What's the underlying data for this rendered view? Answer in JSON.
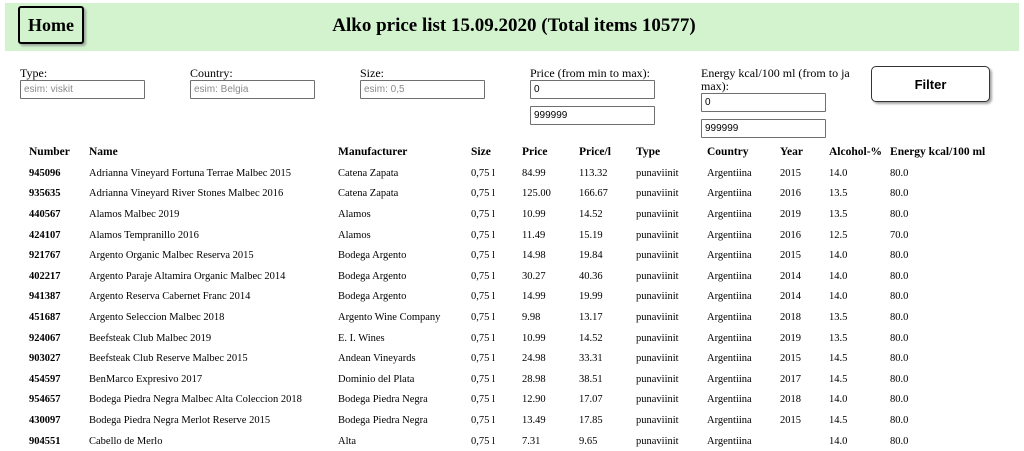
{
  "header": {
    "home_label": "Home",
    "title": "Alko price list 15.09.2020 (Total items 10577)"
  },
  "filters": {
    "type": {
      "label": "Type:",
      "placeholder": "esim: viskit",
      "value": ""
    },
    "country": {
      "label": "Country:",
      "placeholder": "esim: Belgia",
      "value": ""
    },
    "size": {
      "label": "Size:",
      "placeholder": "esim: 0,5",
      "value": ""
    },
    "price": {
      "label": "Price (from min to max):",
      "min": "0",
      "max": "999999"
    },
    "energy": {
      "label": "Energy kcal/100 ml (from to ja max):",
      "min": "0",
      "max": "999999"
    },
    "button_label": "Filter"
  },
  "table": {
    "columns": [
      "Number",
      "Name",
      "Manufacturer",
      "Size",
      "Price",
      "Price/l",
      "Type",
      "Country",
      "Year",
      "Alcohol-%",
      "Energy kcal/100 ml"
    ],
    "rows": [
      [
        "945096",
        "Adrianna Vineyard Fortuna Terrae Malbec 2015",
        "Catena Zapata",
        "0,75 l",
        "84.99",
        "113.32",
        "punaviinit",
        "Argentiina",
        "2015",
        "14.0",
        "80.0"
      ],
      [
        "935635",
        "Adrianna Vineyard River Stones Malbec 2016",
        "Catena Zapata",
        "0,75 l",
        "125.00",
        "166.67",
        "punaviinit",
        "Argentiina",
        "2016",
        "13.5",
        "80.0"
      ],
      [
        "440567",
        "Alamos Malbec 2019",
        "Alamos",
        "0,75 l",
        "10.99",
        "14.52",
        "punaviinit",
        "Argentiina",
        "2019",
        "13.5",
        "80.0"
      ],
      [
        "424107",
        "Alamos Tempranillo 2016",
        "Alamos",
        "0,75 l",
        "11.49",
        "15.19",
        "punaviinit",
        "Argentiina",
        "2016",
        "12.5",
        "70.0"
      ],
      [
        "921767",
        "Argento Organic Malbec Reserva 2015",
        "Bodega Argento",
        "0,75 l",
        "14.98",
        "19.84",
        "punaviinit",
        "Argentiina",
        "2015",
        "14.0",
        "80.0"
      ],
      [
        "402217",
        "Argento Paraje Altamira Organic Malbec 2014",
        "Bodega Argento",
        "0,75 l",
        "30.27",
        "40.36",
        "punaviinit",
        "Argentiina",
        "2014",
        "14.0",
        "80.0"
      ],
      [
        "941387",
        "Argento Reserva Cabernet Franc 2014",
        "Bodega Argento",
        "0,75 l",
        "14.99",
        "19.99",
        "punaviinit",
        "Argentiina",
        "2014",
        "14.0",
        "80.0"
      ],
      [
        "451687",
        "Argento Seleccion Malbec 2018",
        "Argento Wine Company",
        "0,75 l",
        "9.98",
        "13.17",
        "punaviinit",
        "Argentiina",
        "2018",
        "13.5",
        "80.0"
      ],
      [
        "924067",
        "Beefsteak Club Malbec 2019",
        "E. I. Wines",
        "0,75 l",
        "10.99",
        "14.52",
        "punaviinit",
        "Argentiina",
        "2019",
        "13.5",
        "80.0"
      ],
      [
        "903027",
        "Beefsteak Club Reserve Malbec 2015",
        "Andean Vineyards",
        "0,75 l",
        "24.98",
        "33.31",
        "punaviinit",
        "Argentiina",
        "2015",
        "14.5",
        "80.0"
      ],
      [
        "454597",
        "BenMarco Expresivo 2017",
        "Dominio del Plata",
        "0,75 l",
        "28.98",
        "38.51",
        "punaviinit",
        "Argentiina",
        "2017",
        "14.5",
        "80.0"
      ],
      [
        "954657",
        "Bodega Piedra Negra Malbec Alta Coleccion 2018",
        "Bodega Piedra Negra",
        "0,75 l",
        "12.90",
        "17.07",
        "punaviinit",
        "Argentiina",
        "2018",
        "14.0",
        "80.0"
      ],
      [
        "430097",
        "Bodega Piedra Negra Merlot Reserve 2015",
        "Bodega Piedra Negra",
        "0,75 l",
        "13.49",
        "17.85",
        "punaviinit",
        "Argentiina",
        "2015",
        "14.5",
        "80.0"
      ],
      [
        "904551",
        "Cabello de Merlo",
        "Alta",
        "0,75 l",
        "7.31",
        "9.65",
        "punaviinit",
        "Argentiina",
        "",
        "14.0",
        "80.0"
      ]
    ]
  }
}
